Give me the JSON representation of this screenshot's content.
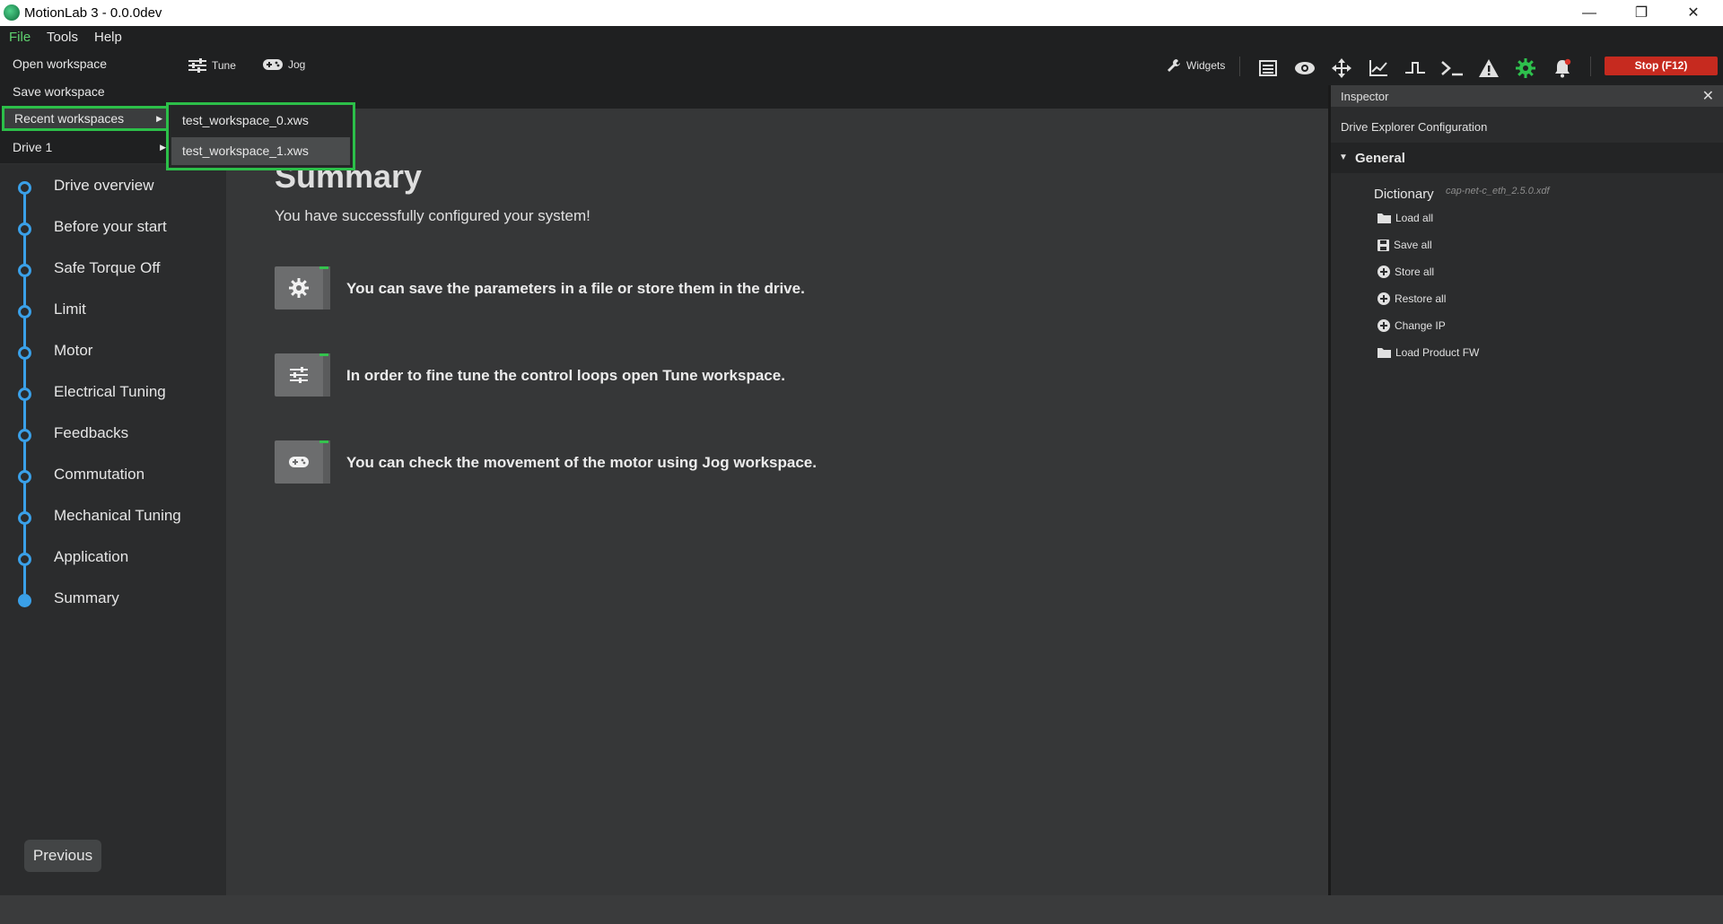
{
  "window": {
    "title": "MotionLab 3 - 0.0.0dev",
    "minimize": "—",
    "restore": "❐",
    "close": "✕"
  },
  "menubar": {
    "file": "File",
    "tools": "Tools",
    "help": "Help"
  },
  "file_menu": {
    "items": [
      "Open workspace",
      "Save workspace",
      "Recent workspaces",
      "Drive 1"
    ],
    "recent_submenu": [
      "test_workspace_0.xws",
      "test_workspace_1.xws"
    ]
  },
  "toolbar": {
    "tune": "Tune",
    "jog": "Jog",
    "widgets": "Widgets",
    "stop": "Stop (F12)"
  },
  "steps": [
    "Drive overview",
    "Before your start",
    "Safe Torque Off",
    "Limit",
    "Motor",
    "Electrical Tuning",
    "Feedbacks",
    "Commutation",
    "Mechanical Tuning",
    "Application",
    "Summary"
  ],
  "previous_button": "Previous",
  "main": {
    "title": "Summary",
    "subtitle": "You have successfully configured your system!",
    "cards": [
      {
        "icon": "gear-icon",
        "text": "You can save the parameters in a file or store them in the drive."
      },
      {
        "icon": "sliders-icon",
        "text": "In order to fine tune the control loops open Tune workspace."
      },
      {
        "icon": "gamepad-icon",
        "text": "You can check the movement of the motor using Jog workspace."
      }
    ]
  },
  "inspector": {
    "title": "Inspector",
    "close": "✕",
    "subtitle": "Drive Explorer Configuration",
    "section": "General",
    "dictionary_label": "Dictionary",
    "dictionary_file": "cap-net-c_eth_2.5.0.xdf",
    "actions": [
      "Load all",
      "Save all",
      "Store all",
      "Restore all",
      "Change IP",
      "Load Product FW"
    ]
  },
  "colors": {
    "accent_green": "#2cbf49",
    "step_blue": "#3aa0e8",
    "stop_red": "#c62a1f"
  }
}
